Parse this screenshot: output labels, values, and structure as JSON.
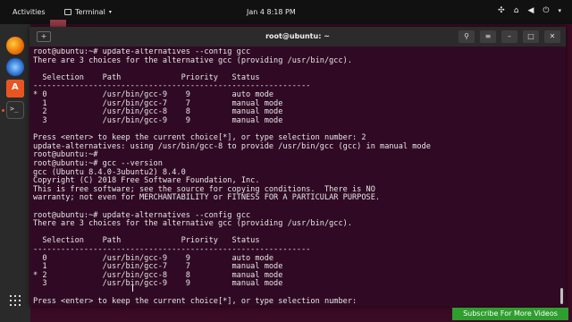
{
  "topbar": {
    "activities": "Activities",
    "app_name": "Terminal",
    "clock": "Jan 4  8:18 PM"
  },
  "window": {
    "title": "root@ubuntu: ~"
  },
  "terminal": {
    "lines": [
      "root@ubuntu:~# update-alternatives --config gcc",
      "There are 3 choices for the alternative gcc (providing /usr/bin/gcc).",
      "",
      "  Selection    Path             Priority   Status",
      "------------------------------------------------------------",
      "* 0            /usr/bin/gcc-9    9         auto mode",
      "  1            /usr/bin/gcc-7    7         manual mode",
      "  2            /usr/bin/gcc-8    8         manual mode",
      "  3            /usr/bin/gcc-9    9         manual mode",
      "",
      "Press <enter> to keep the current choice[*], or type selection number: 2",
      "update-alternatives: using /usr/bin/gcc-8 to provide /usr/bin/gcc (gcc) in manual mode",
      "root@ubuntu:~#",
      "root@ubuntu:~# gcc --version",
      "gcc (Ubuntu 8.4.0-3ubuntu2) 8.4.0",
      "Copyright (C) 2018 Free Software Foundation, Inc.",
      "This is free software; see the source for copying conditions.  There is NO",
      "warranty; not even for MERCHANTABILITY or FITNESS FOR A PARTICULAR PURPOSE.",
      "",
      "root@ubuntu:~# update-alternatives --config gcc",
      "There are 3 choices for the alternative gcc (providing /usr/bin/gcc).",
      "",
      "  Selection    Path             Priority   Status",
      "------------------------------------------------------------",
      "  0            /usr/bin/gcc-9    9         auto mode",
      "  1            /usr/bin/gcc-7    7         manual mode",
      "* 2            /usr/bin/gcc-8    8         manual mode",
      "  3            /usr/bin/gcc-9    9         manual mode",
      "",
      "Press <enter> to keep the current choice[*], or type selection number:"
    ]
  },
  "banner": {
    "subscribe": "Subscribe For More Videos"
  }
}
